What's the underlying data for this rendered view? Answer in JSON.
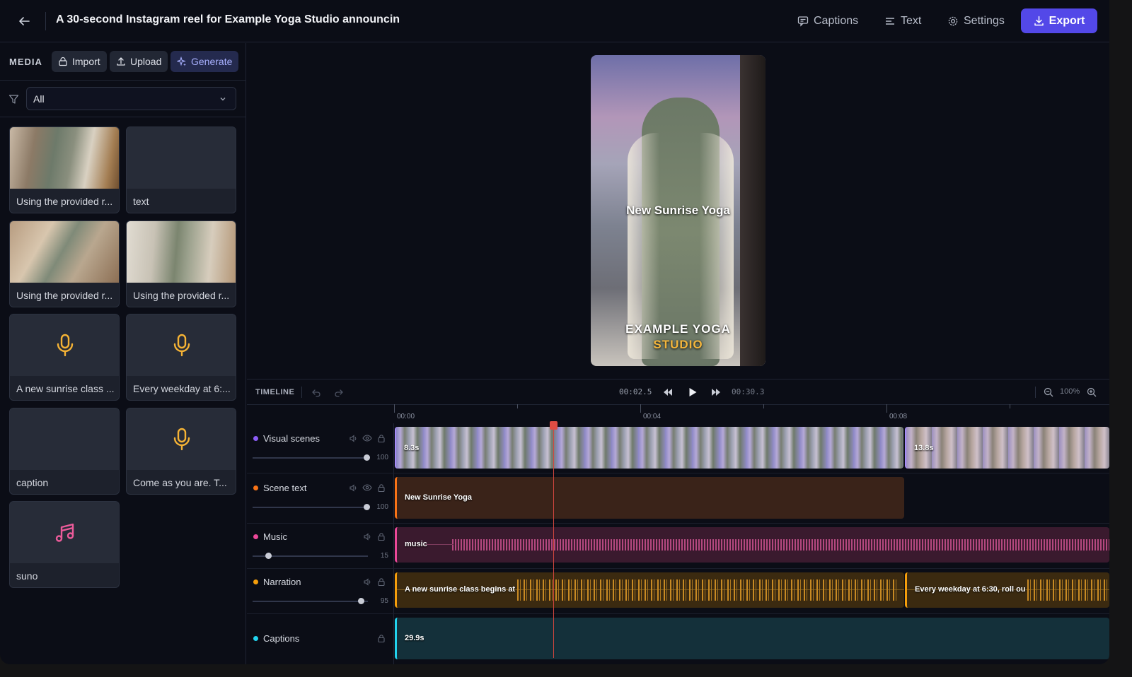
{
  "header": {
    "title": "A 30-second Instagram reel for Example Yoga Studio announcin",
    "captions_label": "Captions",
    "text_label": "Text",
    "settings_label": "Settings",
    "export_label": "Export"
  },
  "media": {
    "heading": "MEDIA",
    "import_label": "Import",
    "upload_label": "Upload",
    "generate_label": "Generate",
    "filter_value": "All",
    "items": [
      {
        "caption": "Using the provided r...",
        "kind": "image"
      },
      {
        "caption": "text",
        "kind": "text"
      },
      {
        "caption": "Using the provided r...",
        "kind": "image"
      },
      {
        "caption": "Using the provided r...",
        "kind": "image"
      },
      {
        "caption": "A new sunrise class ...",
        "kind": "voice"
      },
      {
        "caption": "Every weekday at 6:...",
        "kind": "voice"
      },
      {
        "caption": "caption",
        "kind": "caption"
      },
      {
        "caption": "Come as you are. T...",
        "kind": "voice"
      },
      {
        "caption": "suno",
        "kind": "music"
      }
    ]
  },
  "preview": {
    "title_text": "New Sunrise Yoga",
    "studio_line1": "EXAMPLE YOGA",
    "studio_line2": "STUDIO"
  },
  "timeline": {
    "label": "TIMELINE",
    "current_time": "00:02.5",
    "duration": "00:30.3",
    "zoom": "100%",
    "ruler_labels": [
      "00:00",
      "00:04",
      "00:08"
    ],
    "tracks": [
      {
        "name": "Visual scenes",
        "color": "#8b5cf6",
        "volume": "100",
        "level": 1.0
      },
      {
        "name": "Scene text",
        "color": "#f97316",
        "volume": "100",
        "level": 1.0
      },
      {
        "name": "Music",
        "color": "#ec4899",
        "volume": "15",
        "level": 0.15
      },
      {
        "name": "Narration",
        "color": "#f59e0b",
        "volume": "95",
        "level": 0.95
      },
      {
        "name": "Captions",
        "color": "#22d3ee"
      }
    ],
    "clips": {
      "scene1": "8.3s",
      "scene2": "13.8s",
      "scene_text": "New Sunrise Yoga",
      "music": "music",
      "narration1": "A new sunrise class begins at",
      "narration2": "Every weekday at 6:30, roll ou",
      "captions": "29.9s"
    }
  }
}
